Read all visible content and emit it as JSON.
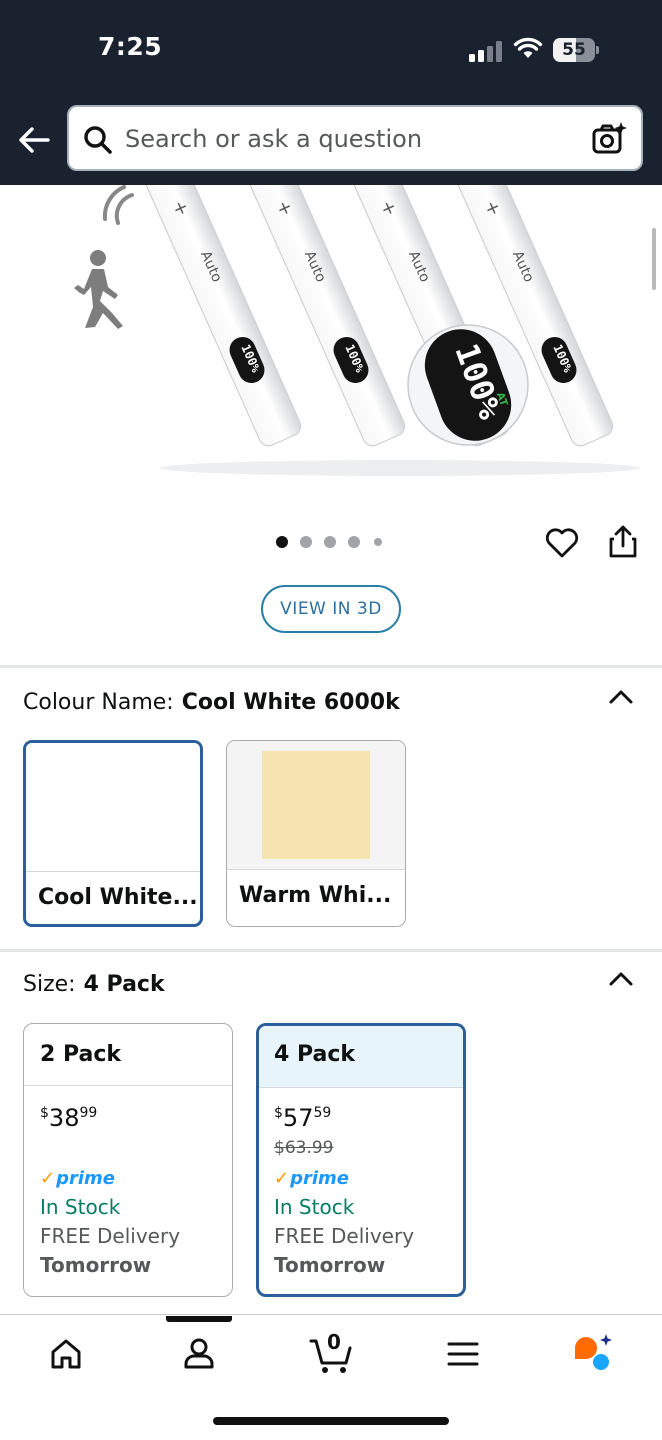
{
  "status_bar": {
    "time": "7:25",
    "battery": "55",
    "battery_level": 0.55
  },
  "search": {
    "placeholder": "Search or ask a question"
  },
  "product_image": {
    "button_label": "Auto",
    "display_reading": "100%",
    "carousel_count": 5,
    "carousel_active": 1
  },
  "view3d_label": "VIEW IN 3D",
  "colour": {
    "label": "Colour Name:",
    "selected": "Cool White 6000k",
    "options": [
      {
        "label": "Cool White...",
        "swatch_color": "#ffffff"
      },
      {
        "label": "Warm Whi...",
        "swatch_color": "#f6e4b0"
      }
    ]
  },
  "size": {
    "label": "Size:",
    "selected": "4 Pack",
    "options": [
      {
        "name": "2 Pack",
        "price_symbol": "$",
        "price_whole": "38",
        "price_fraction": "99",
        "list_price": "",
        "prime": "prime",
        "stock": "In Stock",
        "delivery": "FREE Delivery",
        "delivery_day": "Tomorrow"
      },
      {
        "name": "4 Pack",
        "price_symbol": "$",
        "price_whole": "57",
        "price_fraction": "59",
        "list_price": "$63.99",
        "prime": "prime",
        "stock": "In Stock",
        "delivery": "FREE Delivery",
        "delivery_day": "Tomorrow"
      }
    ]
  },
  "bottom_nav": {
    "items": [
      "home-icon",
      "account-icon",
      "cart-icon",
      "menu-icon",
      "rufus-icon"
    ],
    "cart_count": "0",
    "active": "account-icon"
  },
  "colors": {
    "header_bg": "#1a2230",
    "selected_border": "#2b5f9b",
    "link_blue": "#2b6fa1",
    "stock_green": "#067d62",
    "prime_blue": "#1a98ff",
    "prime_orange": "#ff9900"
  }
}
